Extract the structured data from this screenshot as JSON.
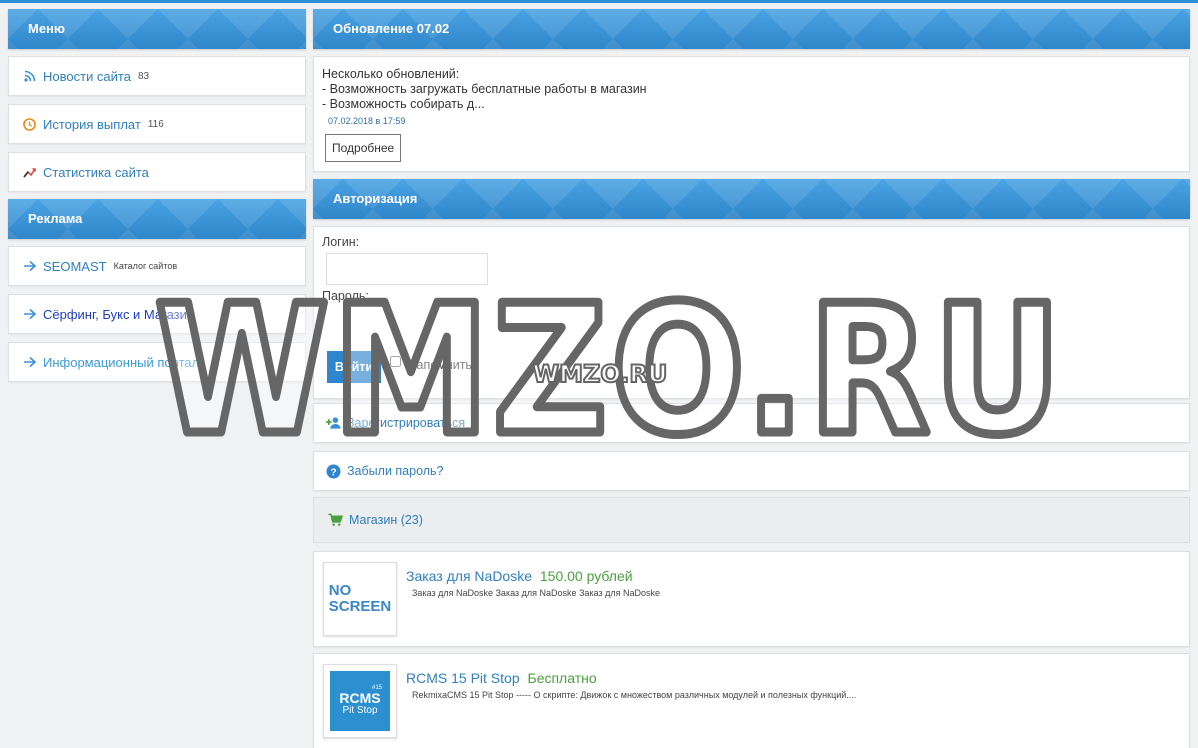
{
  "sidebar": {
    "menu_title": "Меню",
    "menu_items": [
      {
        "label": "Новости сайта",
        "count": "83"
      },
      {
        "label": "История выплат",
        "count": "116"
      },
      {
        "label": "Статистика сайта",
        "count": ""
      }
    ],
    "ads_title": "Реклама",
    "ads_items": [
      {
        "label": "SEOMAST",
        "sub": "Каталог сайтов"
      },
      {
        "label": "Сёрфинг, Букс и Магазин",
        "sub": ""
      },
      {
        "label": "Информационный портал",
        "sub": ""
      }
    ]
  },
  "news": {
    "title": "Обновление 07.02",
    "lines": [
      "Несколько обновлений:",
      "- Возможность загружать бесплатные работы в магазин",
      "- Возможность собирать д..."
    ],
    "date": "07.02.2018 в 17:59",
    "more_label": "Подробнее"
  },
  "auth": {
    "title": "Авторизация",
    "login_label": "Логин:",
    "login_value": "",
    "password_label": "Пароль:",
    "password_value": "",
    "submit_label": "Войти",
    "remember_label": "Запомнить",
    "register_label": "Зарегистрироваться",
    "forgot_label": "Забыли пароль?"
  },
  "shop": {
    "label": "Магазин (23)",
    "products": [
      {
        "title": "Заказ для NaDoske",
        "price": "150.00 рублей",
        "desc": "Заказ для NaDoske Заказ для NaDoske Заказ для NaDoske",
        "thumb_line1": "NO",
        "thumb_line2": "SCREEN"
      },
      {
        "title": "RCMS 15 Pit Stop",
        "price": "Бесплатно",
        "desc": "RekmixaCMS 15 Pit Stop ----- О скрипте: Движок с множеством различных модулей и полезных функций....",
        "thumb_line1": "RCMS",
        "thumb_line2": "Pit Stop",
        "thumb_badge": "#15"
      }
    ]
  },
  "watermark": {
    "big": "WMZO.RU",
    "small": "WMZO.RU"
  },
  "colors": {
    "accent": "#2f86cc",
    "link": "#2f7fbf",
    "price": "#4aa03e"
  },
  "icons": [
    "rss-icon",
    "history-icon",
    "stats-icon",
    "arrow-right-icon",
    "add-user-icon",
    "help-icon",
    "cart-icon"
  ]
}
